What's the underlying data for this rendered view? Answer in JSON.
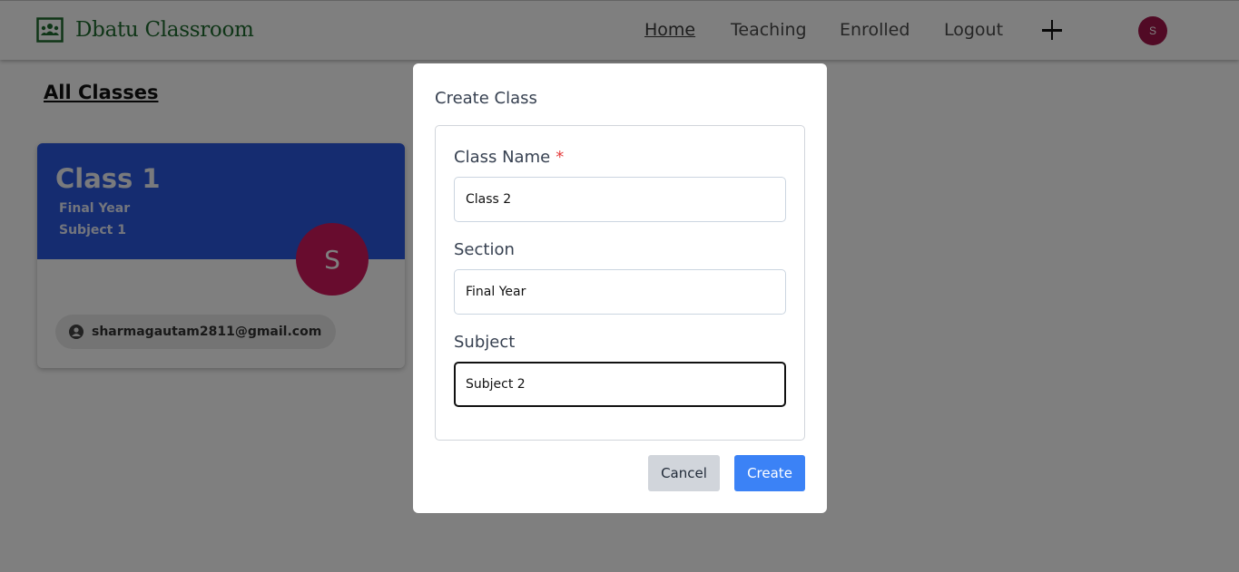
{
  "navbar": {
    "brand": "Dbatu Classroom",
    "brand_icon": "classroom-board-icon",
    "links": [
      {
        "label": "Home",
        "active": true
      },
      {
        "label": "Teaching",
        "active": false
      },
      {
        "label": "Enrolled",
        "active": false
      },
      {
        "label": "Logout",
        "active": false
      }
    ],
    "add_icon": "plus-icon",
    "avatar_initial": "S"
  },
  "main": {
    "heading": "All Classes",
    "cards": [
      {
        "title": "Class 1",
        "section": "Final Year",
        "subject": "Subject 1",
        "avatar_initial": "S",
        "email": "sharmagautam2811@gmail.com",
        "email_icon": "account-circle-icon"
      }
    ]
  },
  "modal": {
    "title": "Create Class",
    "fields": {
      "class_name": {
        "label": "Class Name",
        "required_mark": "*",
        "value": "Class 2"
      },
      "section": {
        "label": "Section",
        "value": "Final Year"
      },
      "subject": {
        "label": "Subject",
        "value": "Subject 2"
      }
    },
    "cancel_label": "Cancel",
    "create_label": "Create"
  },
  "colors": {
    "brand_green": "#1e6b2f",
    "card_header": "#2a58e0",
    "avatar": "#d0185c",
    "primary_button": "#3b82f6",
    "required": "#e53e3e"
  }
}
